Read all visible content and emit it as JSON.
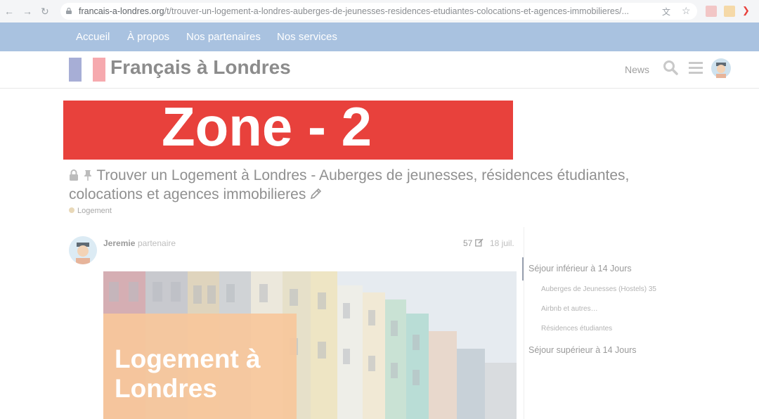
{
  "browser": {
    "url_domain": "francais-a-londres.org",
    "url_path": "/t/trouver-un-logement-a-londres-auberges-de-jeunesses-residences-etudiantes-colocations-et-agences-immobilieres/..."
  },
  "topnav": {
    "items": [
      "Accueil",
      "À propos",
      "Nos partenaires",
      "Nos services"
    ],
    "icons": [
      "twitter-icon",
      "instagram-icon"
    ]
  },
  "header": {
    "site_title": "Français à Londres",
    "news_label": "News"
  },
  "zone_label": "Zone - 2",
  "topic": {
    "title": "Trouver un Logement à Londres - Auberges de jeunesses, résidences étudiantes, colocations et agences immobilieres",
    "category": "Logement"
  },
  "post": {
    "author": "Jeremie",
    "role": "partenaire",
    "count": "57",
    "date": "18 juil.",
    "image_text_line1": "Logement à",
    "image_text_line2": "Londres"
  },
  "toc": {
    "items": [
      {
        "label": "Séjour inférieur à 14 Jours",
        "level": 1
      },
      {
        "label": "Auberges de Jeunesses (Hostels) 35",
        "level": 2
      },
      {
        "label": "Airbnb et autres…",
        "level": 2
      },
      {
        "label": "Résidences étudiantes",
        "level": 2
      },
      {
        "label": "Séjour supérieur à 14 Jours",
        "level": 1
      }
    ]
  },
  "colors": {
    "topnav_bg": "#a9c2e0",
    "zone_banner": "#e8413c",
    "flag_blue": "#a7aed6",
    "flag_red": "#f6a9ae"
  }
}
